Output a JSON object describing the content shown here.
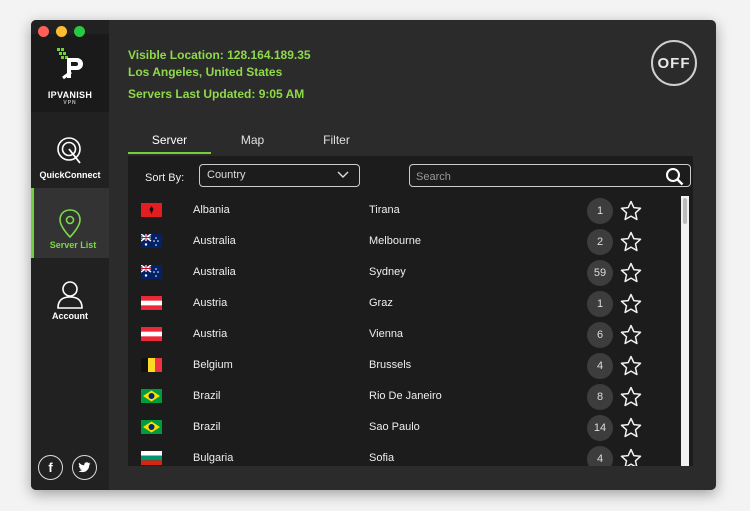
{
  "window": {
    "controls": [
      "close",
      "minimize",
      "zoom"
    ]
  },
  "brand": {
    "name": "IPVANISH",
    "sub": "VPN",
    "accent": "#6fd13c"
  },
  "sidebar": {
    "items": [
      {
        "label": "QuickConnect",
        "icon": "quickconnect-icon"
      },
      {
        "label": "Server List",
        "icon": "map-pin-icon",
        "active": true
      },
      {
        "label": "Account",
        "icon": "user-icon"
      }
    ],
    "social": [
      {
        "glyph": "f",
        "icon": "facebook-icon"
      },
      {
        "glyph": "",
        "icon": "twitter-icon"
      }
    ]
  },
  "header": {
    "visible_location": "Visible Location: 128.164.189.35",
    "city": "Los Angeles, United States",
    "updated": "Servers Last Updated: 9:05 AM",
    "power_label": "OFF"
  },
  "tabs": [
    {
      "label": "Server",
      "active": true
    },
    {
      "label": "Map"
    },
    {
      "label": "Filter"
    }
  ],
  "filters": {
    "sort_label": "Sort By:",
    "sort_value": "Country",
    "search_placeholder": "Search"
  },
  "servers": [
    {
      "flag": "albania",
      "country": "Albania",
      "city": "Tirana",
      "count": "1"
    },
    {
      "flag": "australia",
      "country": "Australia",
      "city": "Melbourne",
      "count": "2"
    },
    {
      "flag": "australia",
      "country": "Australia",
      "city": "Sydney",
      "count": "59"
    },
    {
      "flag": "austria",
      "country": "Austria",
      "city": "Graz",
      "count": "1"
    },
    {
      "flag": "austria",
      "country": "Austria",
      "city": "Vienna",
      "count": "6"
    },
    {
      "flag": "belgium",
      "country": "Belgium",
      "city": "Brussels",
      "count": "4"
    },
    {
      "flag": "brazil",
      "country": "Brazil",
      "city": "Rio De Janeiro",
      "count": "8"
    },
    {
      "flag": "brazil",
      "country": "Brazil",
      "city": "Sao Paulo",
      "count": "14"
    },
    {
      "flag": "bulgaria",
      "country": "Bulgaria",
      "city": "Sofia",
      "count": "4"
    }
  ]
}
